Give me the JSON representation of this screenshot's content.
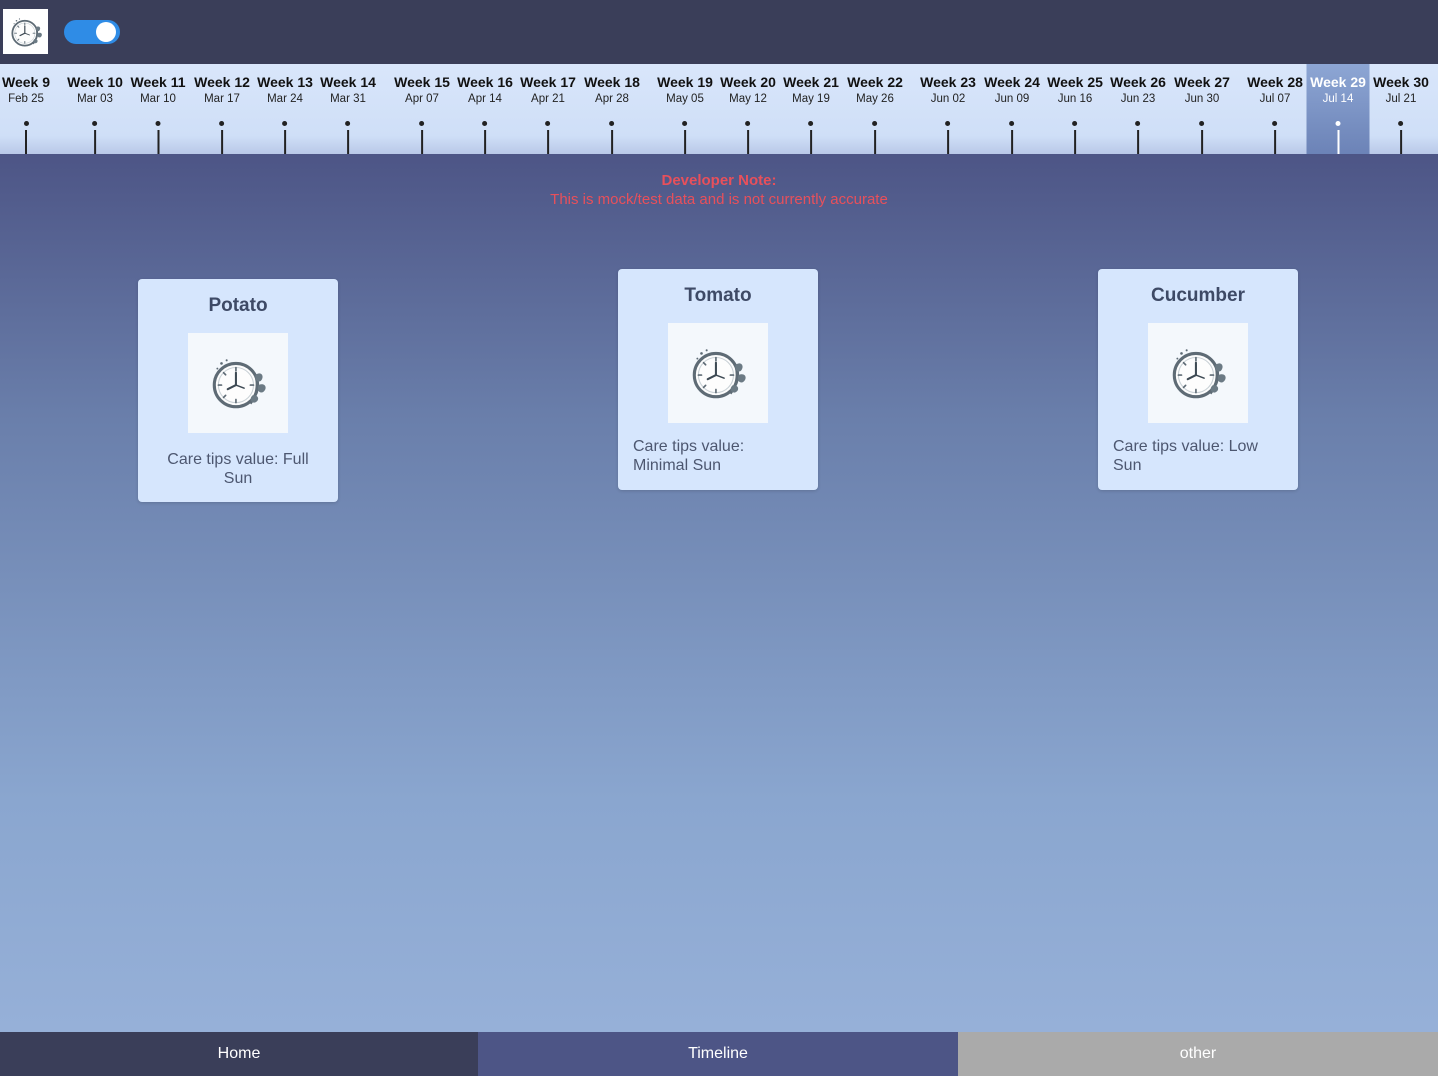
{
  "header": {
    "logo_icon": "clock-leaf-icon",
    "toggle_on": true,
    "toggle_color": "#2f8ce6"
  },
  "timeline": {
    "active_index": 20,
    "weeks": [
      {
        "label": "Week 9",
        "date": "Feb 25"
      },
      {
        "label": "Week 10",
        "date": "Mar 03"
      },
      {
        "label": "Week 11",
        "date": "Mar 10"
      },
      {
        "label": "Week 12",
        "date": "Mar 17"
      },
      {
        "label": "Week 13",
        "date": "Mar 24"
      },
      {
        "label": "Week 14",
        "date": "Mar 31"
      },
      {
        "label": "Week 15",
        "date": "Apr 07"
      },
      {
        "label": "Week 16",
        "date": "Apr 14"
      },
      {
        "label": "Week 17",
        "date": "Apr 21"
      },
      {
        "label": "Week 18",
        "date": "Apr 28"
      },
      {
        "label": "Week 19",
        "date": "May 05"
      },
      {
        "label": "Week 20",
        "date": "May 12"
      },
      {
        "label": "Week 21",
        "date": "May 19"
      },
      {
        "label": "Week 22",
        "date": "May 26"
      },
      {
        "label": "Week 23",
        "date": "Jun 02"
      },
      {
        "label": "Week 24",
        "date": "Jun 09"
      },
      {
        "label": "Week 25",
        "date": "Jun 16"
      },
      {
        "label": "Week 26",
        "date": "Jun 23"
      },
      {
        "label": "Week 27",
        "date": "Jun 30"
      },
      {
        "label": "Week 28",
        "date": "Jul 07"
      },
      {
        "label": "Week 29",
        "date": "Jul 14"
      },
      {
        "label": "Week 30",
        "date": "Jul 21"
      }
    ]
  },
  "dev_note": {
    "title": "Developer Note:",
    "text": "This is mock/test data and is not currently accurate",
    "color": "#e8505b"
  },
  "plants": [
    {
      "name": "Potato",
      "icon": "clock-leaf-icon",
      "care": "Care tips value: Full Sun"
    },
    {
      "name": "Tomato",
      "icon": "clock-leaf-icon",
      "care": "Care tips value: Minimal Sun"
    },
    {
      "name": "Cucumber",
      "icon": "clock-leaf-icon",
      "care": "Care tips value: Low Sun"
    }
  ],
  "nav": {
    "active": "Timeline",
    "tabs": [
      {
        "label": "Home",
        "color": "#3a3e59"
      },
      {
        "label": "Timeline",
        "color": "#4d5586"
      },
      {
        "label": "other",
        "color": "#aaaaaa"
      }
    ]
  }
}
